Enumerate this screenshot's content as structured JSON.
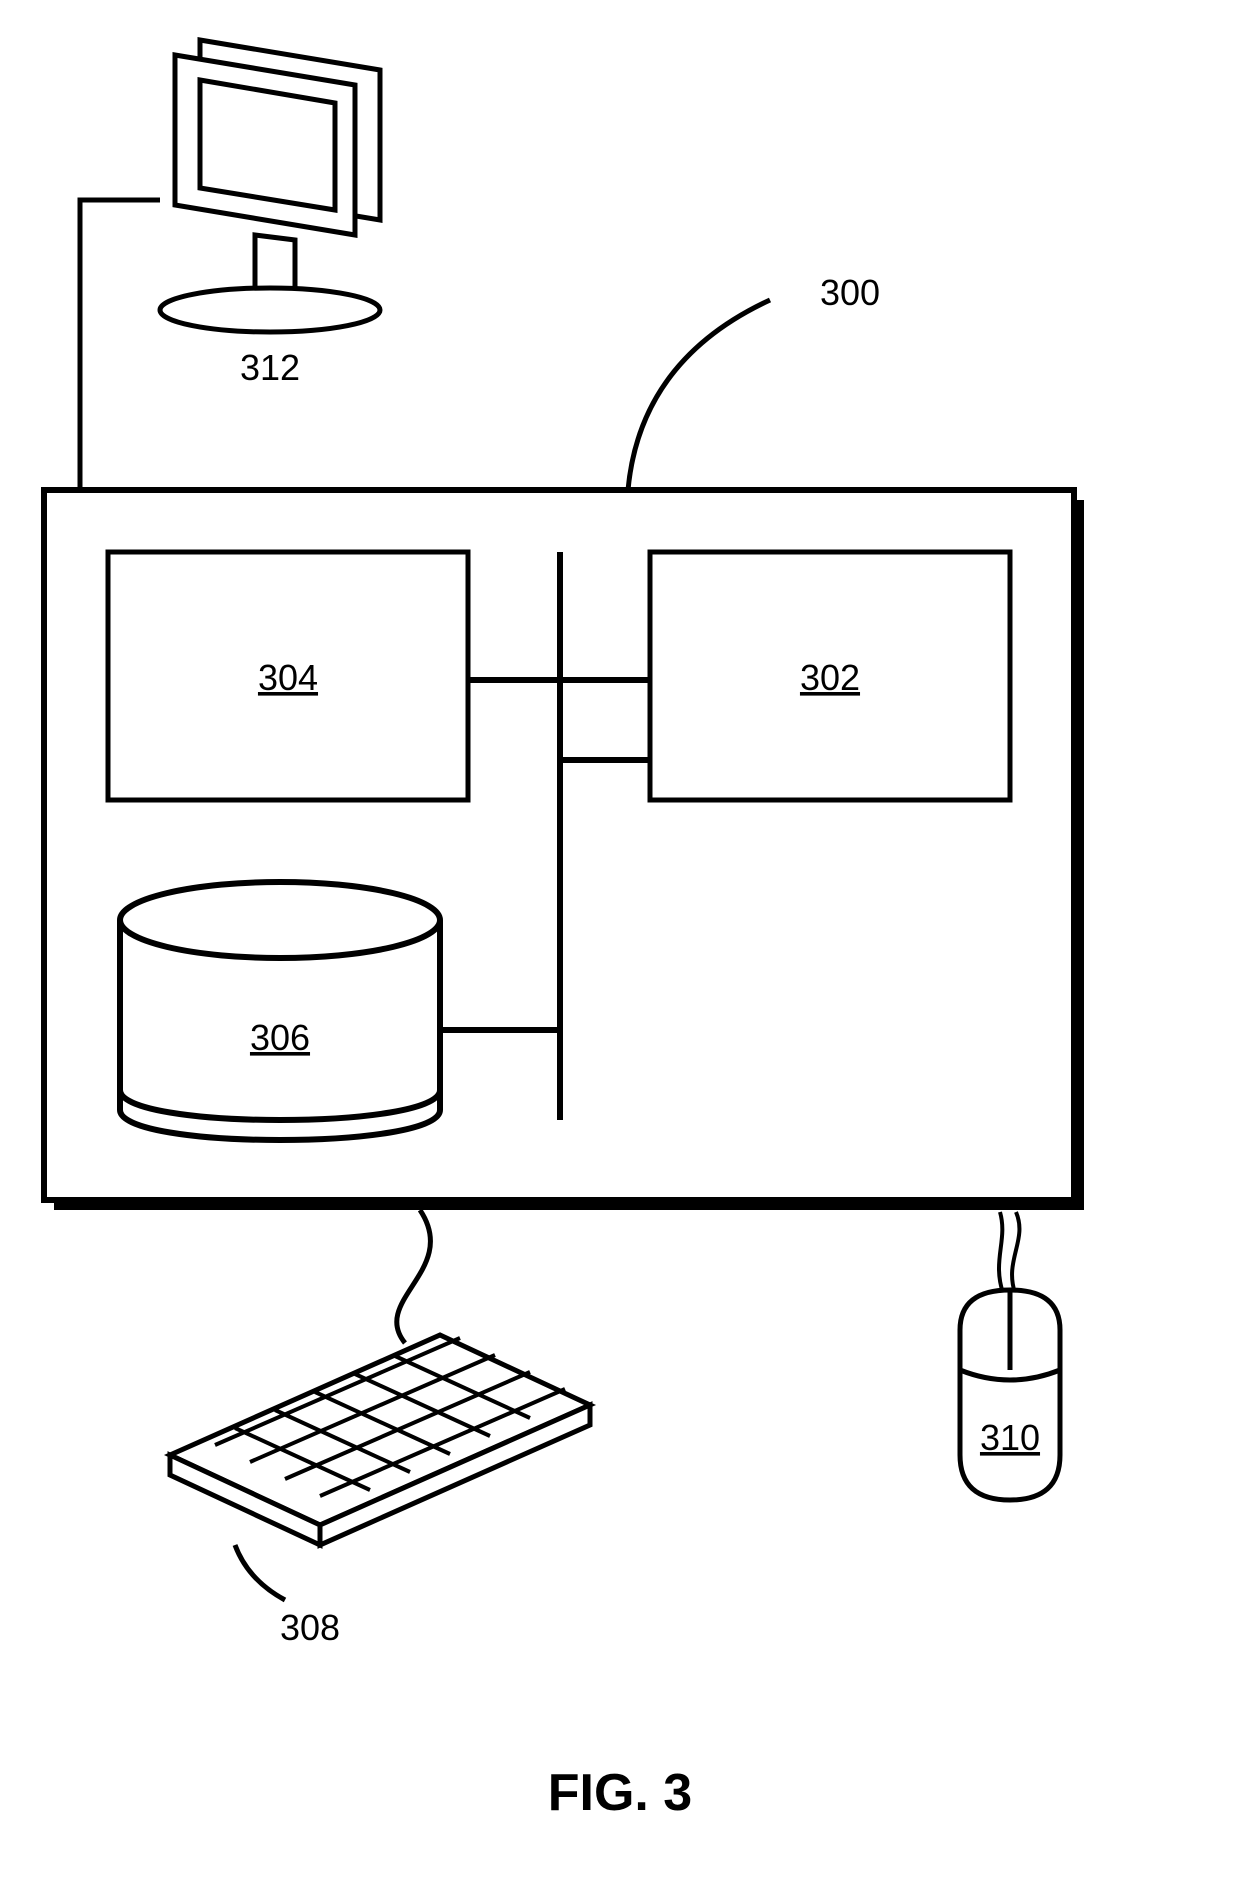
{
  "diagram": {
    "figure_caption": "FIG. 3",
    "system_label": "300",
    "component_box_left": "304",
    "component_box_right": "302",
    "storage_cylinder": "306",
    "keyboard_label": "308",
    "mouse_label": "310",
    "monitor_label": "312"
  }
}
